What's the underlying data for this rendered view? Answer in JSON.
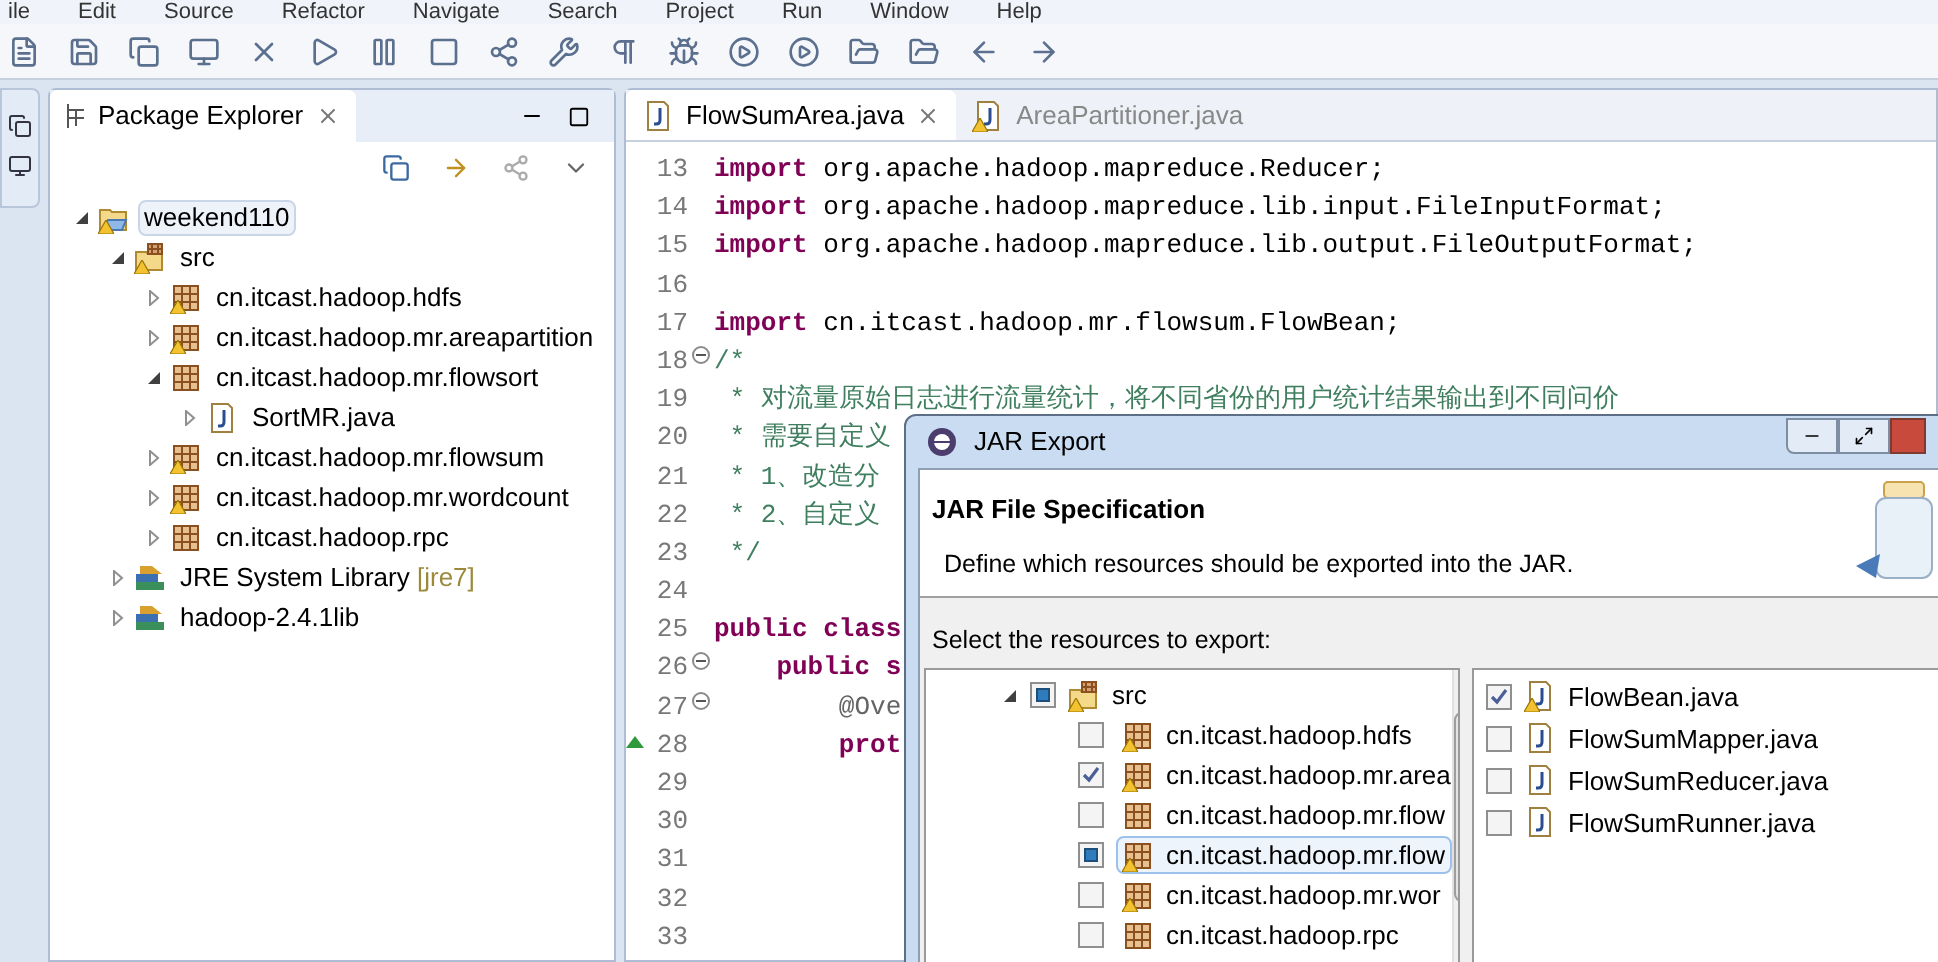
{
  "menu_bar": [
    "ile",
    "Edit",
    "Source",
    "Refactor",
    "Navigate",
    "Search",
    "Project",
    "Run",
    "Window",
    "Help"
  ],
  "package_explorer": {
    "title": "Package Explorer",
    "tree": [
      {
        "label": "weekend110",
        "kind": "project",
        "warning": true,
        "expanded": true,
        "selected": true,
        "children": [
          {
            "label": "src",
            "kind": "source",
            "warning": true,
            "expanded": true,
            "selected": false,
            "children": [
              {
                "label": "cn.itcast.hadoop.hdfs",
                "kind": "package",
                "warning": true,
                "expanded": false,
                "selected": false
              },
              {
                "label": "cn.itcast.hadoop.mr.areapartition",
                "kind": "package",
                "warning": true,
                "expanded": false,
                "selected": false
              },
              {
                "label": "cn.itcast.hadoop.mr.flowsort",
                "kind": "package",
                "warning": false,
                "expanded": true,
                "selected": false,
                "children": [
                  {
                    "label": "SortMR.java",
                    "kind": "java",
                    "warning": false,
                    "expanded": false,
                    "selected": false
                  }
                ]
              },
              {
                "label": "cn.itcast.hadoop.mr.flowsum",
                "kind": "package",
                "warning": true,
                "expanded": false,
                "selected": false
              },
              {
                "label": "cn.itcast.hadoop.mr.wordcount",
                "kind": "package",
                "warning": true,
                "expanded": false,
                "selected": false
              },
              {
                "label": "cn.itcast.hadoop.rpc",
                "kind": "package",
                "warning": false,
                "expanded": false,
                "selected": false
              }
            ]
          },
          {
            "label": "JRE System Library",
            "decoration": "[jre7]",
            "kind": "library",
            "warning": false,
            "expanded": false,
            "selected": false
          },
          {
            "label": "hadoop-2.4.1lib",
            "kind": "library",
            "warning": false,
            "expanded": false,
            "selected": false
          }
        ]
      }
    ]
  },
  "editor": {
    "tabs": [
      {
        "label": "FlowSumArea.java",
        "selected": true,
        "warning": false
      },
      {
        "label": "AreaPartitioner.java",
        "selected": false,
        "warning": true
      }
    ],
    "lines": [
      {
        "number": "13",
        "segments": [
          {
            "kind": "keyword",
            "text": "import"
          },
          {
            "kind": "plain",
            "text": " org.apache.hadoop.mapreduce.Reducer;"
          }
        ]
      },
      {
        "number": "14",
        "segments": [
          {
            "kind": "keyword",
            "text": "import"
          },
          {
            "kind": "plain",
            "text": " org.apache.hadoop.mapreduce.lib.input.FileInputFormat;"
          }
        ]
      },
      {
        "number": "15",
        "segments": [
          {
            "kind": "keyword",
            "text": "import"
          },
          {
            "kind": "plain",
            "text": " org.apache.hadoop.mapreduce.lib.output.FileOutputFormat;"
          }
        ]
      },
      {
        "number": "16"
      },
      {
        "number": "17",
        "segments": [
          {
            "kind": "keyword",
            "text": "import"
          },
          {
            "kind": "plain",
            "text": " cn.itcast.hadoop.mr.flowsum.FlowBean;"
          }
        ]
      },
      {
        "number": "18",
        "fold": true,
        "segments": [
          {
            "kind": "comment",
            "text": "/*"
          }
        ]
      },
      {
        "number": "19",
        "segments": [
          {
            "kind": "comment",
            "text": " * 对流量原始日志进行流量统计，将不同省份的用户统计结果输出到不同问价"
          }
        ]
      },
      {
        "number": "20",
        "segments": [
          {
            "kind": "comment",
            "text": " * 需要自定义"
          }
        ]
      },
      {
        "number": "21",
        "segments": [
          {
            "kind": "comment",
            "text": " * 1、改造分"
          }
        ]
      },
      {
        "number": "22",
        "segments": [
          {
            "kind": "comment",
            "text": " * 2、自定义"
          }
        ]
      },
      {
        "number": "23",
        "segments": [
          {
            "kind": "comment",
            "text": " */"
          }
        ]
      },
      {
        "number": "24"
      },
      {
        "number": "25",
        "segments": [
          {
            "kind": "keyword",
            "text": "public class"
          }
        ]
      },
      {
        "number": "26",
        "fold": true,
        "segments": [
          {
            "kind": "keyword",
            "text": "    public s"
          }
        ]
      },
      {
        "number": "27",
        "fold": true,
        "segments": [
          {
            "kind": "annotation",
            "text": "        @Ove"
          }
        ]
      },
      {
        "number": "28",
        "override": true,
        "segments": [
          {
            "kind": "keyword",
            "text": "        prot"
          }
        ]
      },
      {
        "number": "29"
      },
      {
        "number": "30"
      },
      {
        "number": "31"
      },
      {
        "number": "32"
      },
      {
        "number": "33"
      }
    ]
  },
  "dialog": {
    "title": "JAR Export",
    "heading": "JAR File Specification",
    "description": "Define which resources should be exported into the JAR.",
    "select_label": "Select the resources to export:",
    "tree": {
      "label": "src",
      "checked": true,
      "grayed": true,
      "warning": true,
      "children": [
        {
          "label": "cn.itcast.hadoop.hdfs",
          "checked": false,
          "grayed": false,
          "warning": true,
          "selected": false
        },
        {
          "label": "cn.itcast.hadoop.mr.area",
          "checked": true,
          "grayed": false,
          "warning": true,
          "selected": false
        },
        {
          "label": "cn.itcast.hadoop.mr.flow",
          "checked": false,
          "grayed": false,
          "warning": false,
          "selected": false
        },
        {
          "label": "cn.itcast.hadoop.mr.flow",
          "checked": true,
          "grayed": true,
          "warning": true,
          "selected": true
        },
        {
          "label": "cn.itcast.hadoop.mr.wor",
          "checked": false,
          "grayed": false,
          "warning": true,
          "selected": false
        },
        {
          "label": "cn.itcast.hadoop.rpc",
          "checked": false,
          "grayed": false,
          "warning": false,
          "selected": false
        }
      ]
    },
    "files": [
      {
        "label": "FlowBean.java",
        "checked": true,
        "warning": true
      },
      {
        "label": "FlowSumMapper.java",
        "checked": false,
        "warning": false
      },
      {
        "label": "FlowSumReducer.java",
        "checked": false,
        "warning": false
      },
      {
        "label": "FlowSumRunner.java",
        "checked": false,
        "warning": false
      }
    ]
  }
}
